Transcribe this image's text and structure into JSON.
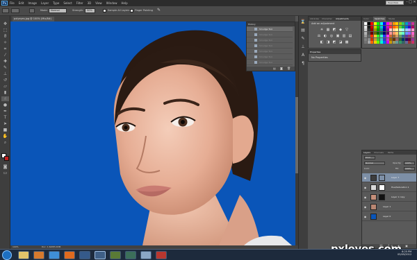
{
  "app": {
    "logo": "Ps"
  },
  "menu": [
    "File",
    "Edit",
    "Image",
    "Layer",
    "Type",
    "Select",
    "Filter",
    "3D",
    "View",
    "Window",
    "Help"
  ],
  "workspace": "Essentials",
  "window_controls": [
    "–",
    "□",
    "✕"
  ],
  "options_bar": {
    "mode_label": "Mode:",
    "mode_value": "Normal",
    "strength_label": "Strength:",
    "strength_value": "50%",
    "sample_all_label": "Sample All Layers",
    "finger_label": "Finger Painting"
  },
  "document": {
    "tab_title": "pxlyeyes.jpg @ 100% (Mix/8#)"
  },
  "statusbar": {
    "zoom": "100%",
    "doc_size": "Doc: 1.62M/5.63M"
  },
  "history": {
    "tab": "History",
    "items": [
      "Smudge Tool",
      "Smudge Tool",
      "Smudge Tool",
      "Smudge Tool",
      "Smudge Tool",
      "Smudge Tool",
      "Smudge Tool"
    ]
  },
  "adjustments": {
    "tabs": [
      "Libraries",
      "Character",
      "Adjustments"
    ],
    "active_tab": "Adjustments",
    "title": "Add an adjustment",
    "icons_row1": [
      "☀",
      "▦",
      "◩",
      "◆",
      "▽"
    ],
    "icons_row2": [
      "⚖",
      "◐",
      "◎",
      "▣",
      "▥",
      "▤"
    ],
    "icons_row3": [
      "◧",
      "◨",
      "◩",
      "◪",
      "▩"
    ]
  },
  "properties": {
    "tab": "Properties",
    "title": "No Properties"
  },
  "swatches": {
    "tabs": [
      "Color",
      "Swatches",
      "Styles"
    ],
    "active_tab": "Swatches",
    "colors": [
      "#ffffff",
      "#000000",
      "#ff0000",
      "#ffff00",
      "#00ff00",
      "#00ffff",
      "#0000ff",
      "#ff00ff",
      "#ff6666",
      "#ff9900",
      "#ffcc00",
      "#99cc00",
      "#33cc66",
      "#0099cc",
      "#6633cc",
      "#cc3399",
      "#e6e6e6",
      "#1a1a1a",
      "#cc0000",
      "#cccc00",
      "#00cc00",
      "#00cccc",
      "#0000cc",
      "#cc00cc",
      "#ff3333",
      "#ff6600",
      "#ff9900",
      "#66cc33",
      "#00aa55",
      "#0066cc",
      "#3300cc",
      "#aa0066",
      "#cccccc",
      "#333333",
      "#990000",
      "#999900",
      "#009900",
      "#009999",
      "#000099",
      "#990099",
      "#ffcccc",
      "#ffcc99",
      "#ffff99",
      "#ccffcc",
      "#99ffff",
      "#99ccff",
      "#cc99ff",
      "#ff99cc",
      "#b3b3b3",
      "#4d4d4d",
      "#660000",
      "#666600",
      "#006600",
      "#006666",
      "#000066",
      "#660066",
      "#ff9999",
      "#ff9966",
      "#ffcc66",
      "#99ff99",
      "#66ffcc",
      "#6699ff",
      "#9966ff",
      "#ff66cc",
      "#999999",
      "#666666",
      "#ff3300",
      "#ffcc33",
      "#33ff33",
      "#33ffcc",
      "#3333ff",
      "#ff33ff",
      "#cc6633",
      "#996633",
      "#cc9966",
      "#669966",
      "#336699",
      "#663399",
      "#993366",
      "#cc6699",
      "#808080",
      "#8c8c8c",
      "#cc3300",
      "#cc9933",
      "#33cc33",
      "#33cccc",
      "#3333cc",
      "#cc33cc",
      "#996600",
      "#663300",
      "#996666",
      "#336633",
      "#003366",
      "#330066",
      "#660033",
      "#993399",
      "#737373",
      "#a6a6a6",
      "#ff6600",
      "#ffcc00",
      "#66ff00",
      "#00ffcc",
      "#0066ff",
      "#cc00ff",
      "#cc9900",
      "#999966",
      "#669999",
      "#339966",
      "#336666",
      "#666699",
      "#993333",
      "#cc3366"
    ]
  },
  "layers": {
    "tabs": [
      "Layers",
      "Channels",
      "Paths"
    ],
    "active_tab": "Layers",
    "kind_label": "Kind",
    "blend_mode": "Normal",
    "opacity_label": "Opacity:",
    "opacity_value": "100%",
    "lock_label": "Lock:",
    "fill_label": "Fill:",
    "fill_value": "100%",
    "items": [
      {
        "name": "Layer 7",
        "thumb": "#ffffff",
        "mask": "",
        "selected": true
      },
      {
        "name": "Hue/Saturation 1",
        "thumb": "#ffffff",
        "mask": "#ffffff",
        "selected": false
      },
      {
        "name": "Layer 1 copy",
        "thumb": "#c58f7a",
        "mask": "#111111",
        "selected": false
      },
      {
        "name": "Layer 1",
        "thumb": "#b88672",
        "mask": "",
        "selected": false
      },
      {
        "name": "Layer 0",
        "thumb": "#0a55b8",
        "mask": "",
        "selected": false
      }
    ],
    "footer_icons": "⛓ fx ◐ ▣ ▤ 🗑"
  },
  "taskbar": {
    "apps": [
      "explorer",
      "media",
      "firefox",
      "chrome",
      "firefox",
      "winamp",
      "photoshop",
      "bridge",
      "folder",
      "notes",
      "tablet",
      "paint"
    ],
    "time": "6:25 PM",
    "date": "05/05/2012"
  },
  "watermark": "pxleyes.com"
}
